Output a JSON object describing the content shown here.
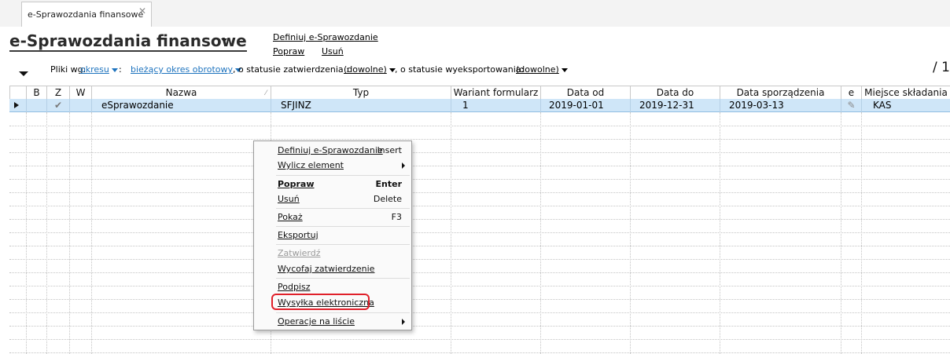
{
  "tab": {
    "label": "e-Sprawozdania finansowe",
    "close": "✕"
  },
  "header": {
    "title": "e-Sprawozdania finansowe",
    "links": {
      "define": "Definiuj e-Sprawozdanie",
      "edit": "Popraw",
      "delete": "Usuń"
    }
  },
  "filter": {
    "prefix": "Pliki wg:",
    "by": "okresu",
    "sep": ":",
    "period": "bieżący okres obrotowy",
    "approval_text": ", o statusie zatwierdzenia :",
    "approval_value": "(dowolne)",
    "export_text": ", o statusie wyeksportowania:",
    "export_value": "(dowolne)",
    "page_count": "/ 1"
  },
  "table": {
    "columns": [
      "B",
      "Z",
      "W",
      "Nazwa",
      "Typ",
      "Wariant formularz",
      "Data od",
      "Data do",
      "Data sporządzenia",
      "e",
      "Miejsce składania"
    ],
    "rows": [
      {
        "z_check": "✔",
        "nazwa": "eSprawozdanie",
        "typ": "SFJINZ",
        "wariant": "1",
        "data_od": "2019-01-01",
        "data_do": "2019-12-31",
        "data_sporzadzenia": "2019-03-13",
        "e_icon": "✎",
        "miejsce": "KAS"
      }
    ]
  },
  "context_menu": {
    "define": {
      "label": "Definiuj e-Sprawozdanie",
      "shortcut": "Insert"
    },
    "compute": {
      "label": "Wylicz element"
    },
    "edit": {
      "label": "Popraw",
      "shortcut": "Enter"
    },
    "delete": {
      "label": "Usuń",
      "shortcut": "Delete"
    },
    "show": {
      "label": "Pokaż",
      "shortcut": "F3"
    },
    "export": {
      "label": "Eksportuj"
    },
    "approve": {
      "label": "Zatwierdź"
    },
    "withdraw": {
      "label": "Wycofaj zatwierdzenie"
    },
    "sign": {
      "label": "Podpisz"
    },
    "send": {
      "label": "Wysyłka elektroniczna"
    },
    "list_ops": {
      "label": "Operacje na liście"
    }
  },
  "colors": {
    "selected_row": "#cfe6f8",
    "link_blue": "#1e73be",
    "highlight_red": "#e0202a"
  }
}
